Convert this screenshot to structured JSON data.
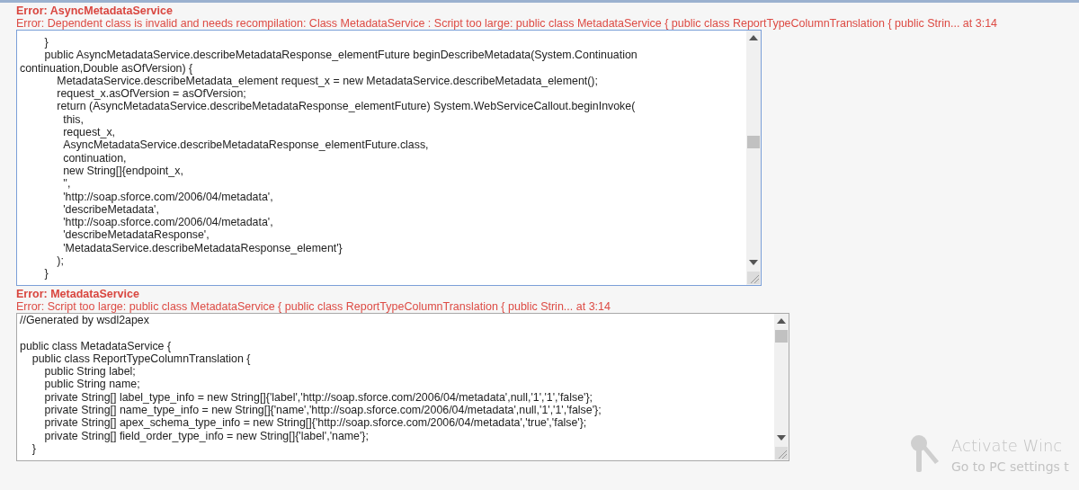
{
  "errors": [
    {
      "title": "Error: AsyncMetadataService",
      "message": "Error: Dependent class is invalid and needs recompilation: Class MetadataService : Script too large: public class MetadataService { public class ReportTypeColumnTranslation { public Strin... at 3:14",
      "focused": true,
      "code_lines": [
        "        }",
        "        public AsyncMetadataService.describeMetadataResponse_elementFuture beginDescribeMetadata(System.Continuation",
        "continuation,Double asOfVersion) {",
        "            MetadataService.describeMetadata_element request_x = new MetadataService.describeMetadata_element();",
        "            request_x.asOfVersion = asOfVersion;",
        "            return (AsyncMetadataService.describeMetadataResponse_elementFuture) System.WebServiceCallout.beginInvoke(",
        "              this,",
        "              request_x,",
        "              AsyncMetadataService.describeMetadataResponse_elementFuture.class,",
        "              continuation,",
        "              new String[]{endpoint_x,",
        "              '',",
        "              'http://soap.sforce.com/2006/04/metadata',",
        "              'describeMetadata',",
        "              'http://soap.sforce.com/2006/04/metadata',",
        "              'describeMetadataResponse',",
        "              'MetadataService.describeMetadataResponse_element'}",
        "            );",
        "        }"
      ]
    },
    {
      "title": "Error: MetadataService",
      "message": "Error: Script too large: public class MetadataService { public class ReportTypeColumnTranslation { public Strin... at 3:14",
      "focused": false,
      "code_lines": [
        "//Generated by wsdl2apex",
        {
          "text": "public class MetadataService {",
          "blank_before": true
        },
        "    public class ReportTypeColumnTranslation {",
        "        public String label;",
        "        public String name;",
        "        private String[] label_type_info = new String[]{'label','http://soap.sforce.com/2006/04/metadata',null,'1','1','false'};",
        "        private String[] name_type_info = new String[]{'name','http://soap.sforce.com/2006/04/metadata',null,'1','1','false'};",
        "        private String[] apex_schema_type_info = new String[]{'http://soap.sforce.com/2006/04/metadata','true','false'};",
        "        private String[] field_order_type_info = new String[]{'label','name'};",
        "    }"
      ]
    }
  ],
  "activation_notice": {
    "title": "Activate Winc",
    "subtitle": "Go to PC settings t"
  }
}
